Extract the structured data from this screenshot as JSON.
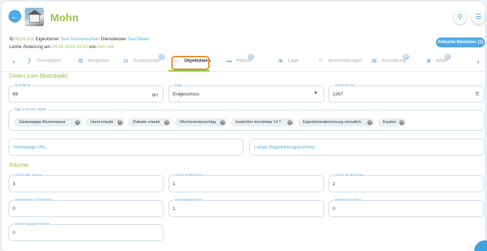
{
  "header": {
    "title": "Mohn",
    "back_icon": "arrow-left-icon",
    "share_icon": "share-icon",
    "menu_icon": "list-menu-icon"
  },
  "meta": {
    "id_label": "ID",
    "id_value": "8219.151",
    "owner_label": "Eigentümer",
    "owner_value": "Susi Sonnenschein",
    "provider_label": "Dienstleister",
    "provider_value": "Susi Maier",
    "changed_label": "Letzte Änderung am",
    "changed_value": "24.02.2025 15:52",
    "by_label": "von",
    "by_value": "null null"
  },
  "current_users_button": "Aktuelle Benutzer (1)",
  "tabs": [
    {
      "label": "Grunddaten",
      "icon": "chevron-icon",
      "badge": ""
    },
    {
      "label": "Mietpreise",
      "icon": "chart-icon",
      "badge": ""
    },
    {
      "label": "Zusatzkosten",
      "icon": "receipt-icon",
      "badge": "0"
    },
    {
      "label": "Objektdaten",
      "icon": "home-icon",
      "badge": ""
    },
    {
      "label": "Räume",
      "icon": "bed-icon",
      "badge": "0"
    },
    {
      "label": "Lage",
      "icon": "map-pin-icon",
      "badge": ""
    },
    {
      "label": "Beschreibungen",
      "icon": "text-icon",
      "badge": ""
    },
    {
      "label": "Ausstattung",
      "icon": "building-icon",
      "badge": "36"
    },
    {
      "label": "Bilder",
      "icon": "image-icon",
      "badge": "6"
    }
  ],
  "section_mietobjekt": "Daten zum Mietobjekt",
  "wohnflaeche": {
    "label": "Wohnfläche",
    "value": "69",
    "suffix": "qm"
  },
  "etage": {
    "label": "Etage",
    "value": "Erdgeschoss"
  },
  "schluesselcode": {
    "label": "Schlüsselcode",
    "value": "1267"
  },
  "tags": {
    "label": "Tags zu diesem Objekt",
    "items": [
      "Gästemappe Blumenwiese",
      "Hund erlaubt",
      "Rabatte erlaubt",
      "Wochenendzuschlag",
      "kostenfrei stornierbar 14 T",
      "Eigentümerabrechnung monatlich",
      "Kaution"
    ]
  },
  "homepage_url": {
    "placeholder": "Homepage URL"
  },
  "lokale_registrierung": {
    "placeholder": "Lokale Registrierungsnummer"
  },
  "section_raeume": "Räume",
  "rooms": [
    {
      "label": "Anzahl aller Zimmer",
      "value": "3"
    },
    {
      "label": "Anzahl Wohnzimmer",
      "value": "1"
    },
    {
      "label": "Anzahl Schlafzimmer",
      "value": "2"
    },
    {
      "label": "Anzahl Wohn-Schlafzimmer",
      "value": "0"
    },
    {
      "label": "Anzahl Badezimmer",
      "value": "1"
    },
    {
      "label": "Anzahl Gäste-WCs",
      "value": "0"
    },
    {
      "label": "Anzahl separater Küchen",
      "value": "0"
    }
  ],
  "colors": {
    "accent_green": "#9ac446",
    "accent_blue": "#4fa9e4",
    "highlight_orange": "#e88a2a"
  }
}
